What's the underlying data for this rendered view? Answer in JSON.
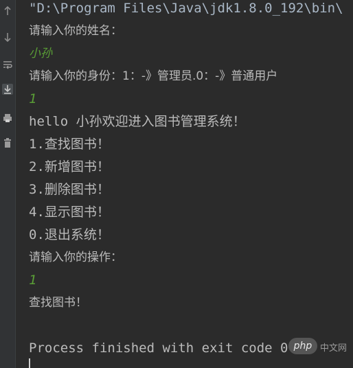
{
  "toolbar_icons": [
    "arrow-up-icon",
    "arrow-down-icon",
    "soft-wrap-icon",
    "scroll-to-end-icon",
    "print-icon",
    "trash-icon"
  ],
  "console": {
    "lines": [
      "\"D:\\Program Files\\Java\\jdk1.8.0_192\\bin\\",
      "请输入你的姓名：",
      "小孙",
      "请输入你的身份：1：-》管理员.0：-》普通用户",
      "1",
      "hello 小孙欢迎进入图书管理系统！",
      "1.查找图书！",
      "2.新增图书！",
      "3.删除图书！",
      "4.显示图书！",
      "0.退出系统！",
      "请输入你的操作：",
      "1",
      "查找图书！",
      "",
      "Process finished with exit code 0"
    ]
  },
  "watermark": {
    "logo": "php",
    "site": "中文网"
  },
  "colors": {
    "background": "#2b2b2b",
    "text": "#bbbbbb",
    "user_input": "#5a9e36"
  }
}
